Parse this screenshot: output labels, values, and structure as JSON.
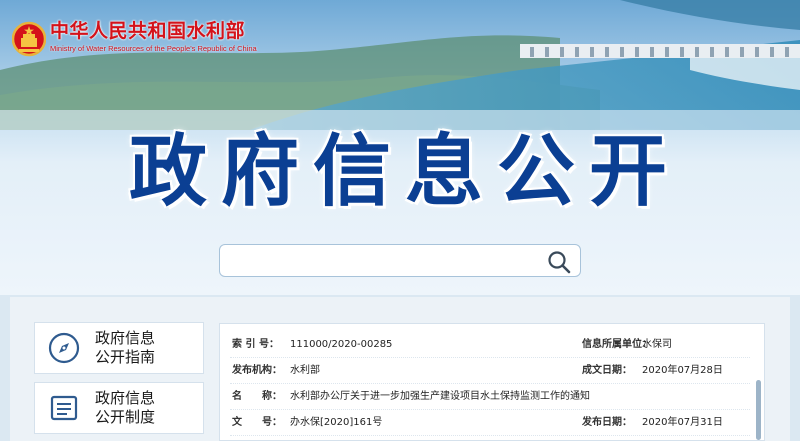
{
  "header": {
    "ministry_cn": "中华人民共和国水利部",
    "ministry_en": "Ministry of Water Resources of the People's Republic of China",
    "emblem_icon": "national-emblem-icon",
    "brand_red": "#d4121a"
  },
  "banner": {
    "title": "政府信息公开",
    "title_color": "#0b3f93"
  },
  "search": {
    "placeholder": "",
    "icon": "search-icon"
  },
  "sidebar": {
    "items": [
      {
        "line1": "政府信息",
        "line2": "公开指南",
        "icon": "compass-icon"
      },
      {
        "line1": "政府信息",
        "line2": "公开制度",
        "icon": "document-list-icon"
      }
    ]
  },
  "info": {
    "rows": [
      {
        "label": "索 引 号：",
        "value": "111000/2020-00285",
        "right_label": "信息所属单位：",
        "right_value": "水保司"
      },
      {
        "label": "发布机构：",
        "value": "水利部",
        "right_label": "成文日期：",
        "right_value": "2020年07月28日"
      },
      {
        "label": "名　　称：",
        "value": "水利部办公厅关于进一步加强生产建设项目水土保持监测工作的通知",
        "right_label": "",
        "right_value": ""
      },
      {
        "label": "文　　号：",
        "value": "办水保[2020]161号",
        "right_label": "发布日期：",
        "right_value": "2020年07月31日"
      }
    ]
  }
}
